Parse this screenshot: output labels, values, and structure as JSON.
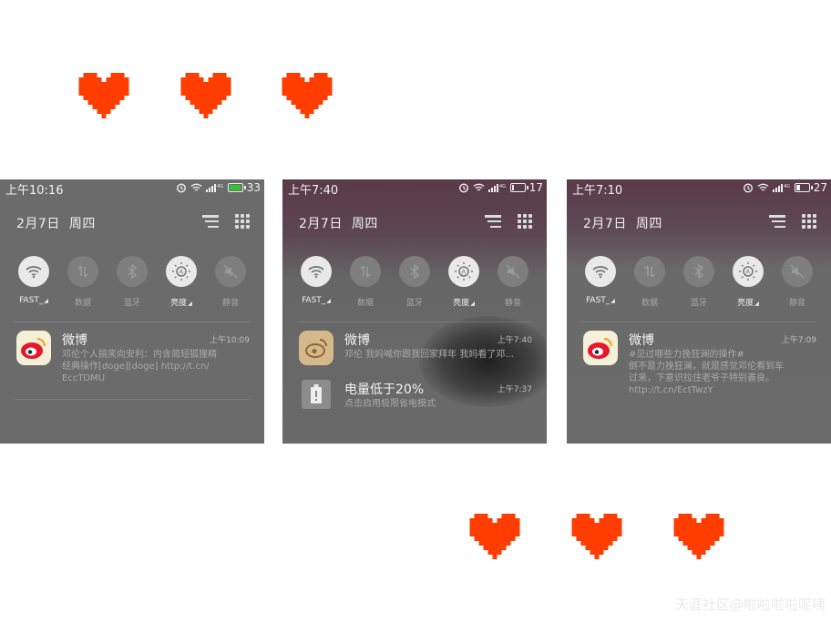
{
  "colors": {
    "heart": "#ff3d00",
    "battery_green": "#2fc52f",
    "toggle_on": "#e9e9e9",
    "toggle_off": "#7e7e7e"
  },
  "panels": [
    {
      "status": {
        "time": "上午10:16",
        "battery": "33",
        "battery_level": 0.9,
        "icons": [
          "alarm-icon",
          "wifi-icon",
          "signal-4g-icon",
          "battery-icon"
        ]
      },
      "date": "2月7日",
      "weekday": "周四",
      "toggles": [
        {
          "label": "FAST_",
          "icon": "wifi-icon",
          "on": true
        },
        {
          "label": "数据",
          "icon": "data-icon",
          "on": false
        },
        {
          "label": "蓝牙",
          "icon": "bluetooth-icon",
          "on": false
        },
        {
          "label": "亮度",
          "icon": "brightness-icon",
          "on": true
        },
        {
          "label": "静音",
          "icon": "mute-icon",
          "on": false
        }
      ],
      "notifications": [
        {
          "app": "微博",
          "icon": "weibo-icon",
          "time": "上午10:09",
          "lines": [
            "邓伦个人搞笑向安利：内含简短狐狸精",
            "经典操作[doge][doge] http://t.cn/",
            "EccTDMU"
          ]
        }
      ]
    },
    {
      "status": {
        "time": "上午7:40",
        "battery": "17",
        "battery_level": 0.17,
        "icons": [
          "alarm-icon",
          "wifi-icon",
          "signal-4g-icon",
          "battery-icon"
        ]
      },
      "date": "2月7日",
      "weekday": "周四",
      "toggles": [
        {
          "label": "FAST_",
          "icon": "wifi-icon",
          "on": true
        },
        {
          "label": "数据",
          "icon": "data-icon",
          "on": false
        },
        {
          "label": "蓝牙",
          "icon": "bluetooth-icon",
          "on": false
        },
        {
          "label": "亮度",
          "icon": "brightness-icon",
          "on": true
        },
        {
          "label": "静音",
          "icon": "mute-icon",
          "on": false
        }
      ],
      "notifications": [
        {
          "app": "微博",
          "icon": "weibo-icon",
          "time": "上午7:40",
          "lines": [
            "邓伦 我妈喊你跟我回家拜年 我妈看了邓..."
          ]
        },
        {
          "app": "电量低于20%",
          "icon": "battery-alert-icon",
          "time": "上午7:37",
          "lines": [
            "点击启用极限省电模式"
          ]
        }
      ]
    },
    {
      "status": {
        "time": "上午7:10",
        "battery": "27",
        "battery_level": 0.27,
        "icons": [
          "alarm-icon",
          "wifi-icon",
          "signal-4g-icon",
          "battery-icon"
        ]
      },
      "date": "2月7日",
      "weekday": "周四",
      "toggles": [
        {
          "label": "FAST_",
          "icon": "wifi-icon",
          "on": true
        },
        {
          "label": "数据",
          "icon": "data-icon",
          "on": false
        },
        {
          "label": "蓝牙",
          "icon": "bluetooth-icon",
          "on": false
        },
        {
          "label": "亮度",
          "icon": "brightness-icon",
          "on": true
        },
        {
          "label": "静音",
          "icon": "mute-icon",
          "on": false
        }
      ],
      "notifications": [
        {
          "app": "微博",
          "icon": "weibo-icon",
          "time": "上午7:09",
          "lines": [
            "#见过哪些力挽狂澜的操作#",
            "倒不是力挽狂澜，就是感觉邓伦看到车",
            "过来，下意识拉住老爷子特别善良。",
            "http://t.cn/EctTwzY"
          ]
        }
      ]
    }
  ],
  "watermark": "天涯社区@啦啦啦啦呢咦"
}
